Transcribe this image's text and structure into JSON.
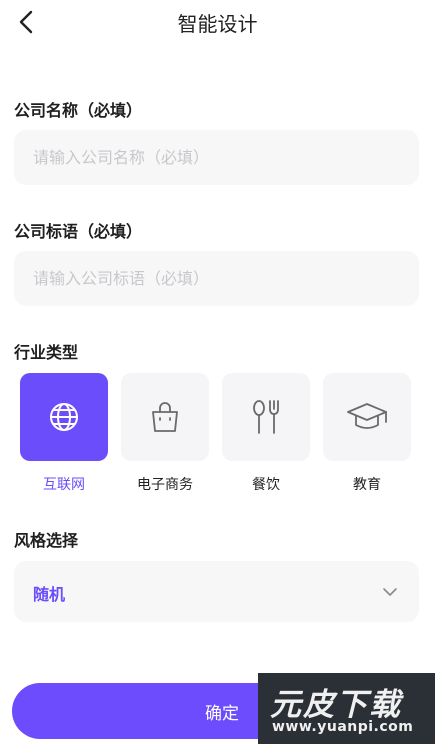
{
  "header": {
    "title": "智能设计"
  },
  "company_name": {
    "label": "公司名称（必填）",
    "placeholder": "请输入公司名称（必填）",
    "value": ""
  },
  "company_slogan": {
    "label": "公司标语（必填）",
    "placeholder": "请输入公司标语（必填）",
    "value": ""
  },
  "industry": {
    "label": "行业类型",
    "selected": "互联网",
    "items": [
      {
        "label": "互联网",
        "icon": "globe-icon",
        "active": true
      },
      {
        "label": "电子商务",
        "icon": "shopping-bag-icon",
        "active": false
      },
      {
        "label": "餐饮",
        "icon": "spoon-fork-icon",
        "active": false
      },
      {
        "label": "教育",
        "icon": "graduation-cap-icon",
        "active": false
      }
    ]
  },
  "style": {
    "label": "风格选择",
    "value": "随机",
    "icon": "chevron-down-icon"
  },
  "confirm_label": "确定",
  "watermark": {
    "main": "元皮下载",
    "sub": "www.yuanpi.com"
  },
  "colors": {
    "accent": "#6b4dfc",
    "field_bg": "#f7f7f8",
    "tile_bg": "#f5f5f7"
  }
}
